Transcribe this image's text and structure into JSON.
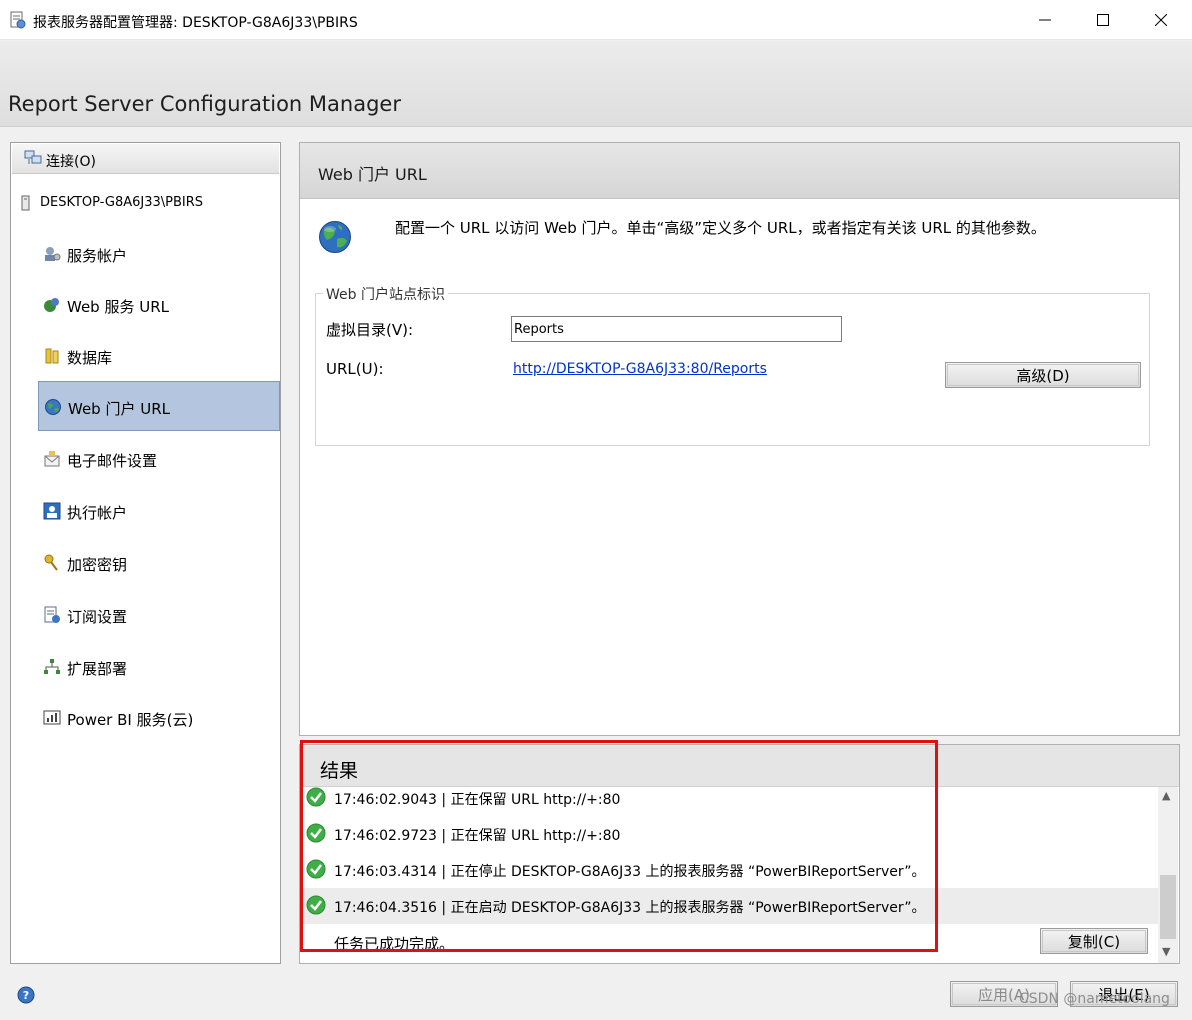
{
  "window": {
    "title": "报表服务器配置管理器: DESKTOP-G8A6J33\\PBIRS"
  },
  "banner": {
    "heading": "Report Server Configuration Manager"
  },
  "sidebar": {
    "connect_label": "连接(O)",
    "server_name": "DESKTOP-G8A6J33\\PBIRS",
    "items": [
      {
        "label": "服务帐户",
        "icon": "service-account-icon"
      },
      {
        "label": "Web 服务 URL",
        "icon": "web-service-icon"
      },
      {
        "label": "数据库",
        "icon": "database-icon"
      },
      {
        "label": "Web 门户 URL",
        "icon": "globe-icon",
        "selected": true
      },
      {
        "label": "电子邮件设置",
        "icon": "email-icon"
      },
      {
        "label": "执行帐户",
        "icon": "execution-account-icon"
      },
      {
        "label": "加密密钥",
        "icon": "keys-icon"
      },
      {
        "label": "订阅设置",
        "icon": "subscription-icon"
      },
      {
        "label": "扩展部署",
        "icon": "scale-out-icon"
      },
      {
        "label": "Power BI 服务(云)",
        "icon": "power-bi-icon"
      }
    ]
  },
  "main": {
    "header": "Web 门户 URL",
    "description": "配置一个 URL 以访问 Web 门户。单击“高级”定义多个 URL，或者指定有关该 URL 的其他参数。",
    "group_title": "Web 门户站点标识",
    "virtual_dir_label": "虚拟目录(V):",
    "virtual_dir_value": "Reports",
    "url_label": "URL(U):",
    "url_value": "http://DESKTOP-G8A6J33:80/Reports",
    "advanced_button": "高级(D)"
  },
  "results": {
    "header": "结果",
    "log": [
      "17:46:02.9043 | 正在保留 URL http://+:80",
      "17:46:02.9723 | 正在保留 URL http://+:80",
      "17:46:03.4314 | 正在停止 DESKTOP-G8A6J33 上的报表服务器 “PowerBIReportServer”。",
      "17:46:04.3516 | 正在启动 DESKTOP-G8A6J33 上的报表服务器 “PowerBIReportServer”。"
    ],
    "done_text": "任务已成功完成。",
    "copy_button": "复制(C)"
  },
  "footer": {
    "apply_button": "应用(A)",
    "exit_button": "退出(E)",
    "watermark": "CSDN @nametoolang"
  },
  "colors": {
    "selection": "#b4c6df",
    "highlight_box": "#e01010",
    "link": "#0033cc",
    "success": "#3fae49"
  }
}
